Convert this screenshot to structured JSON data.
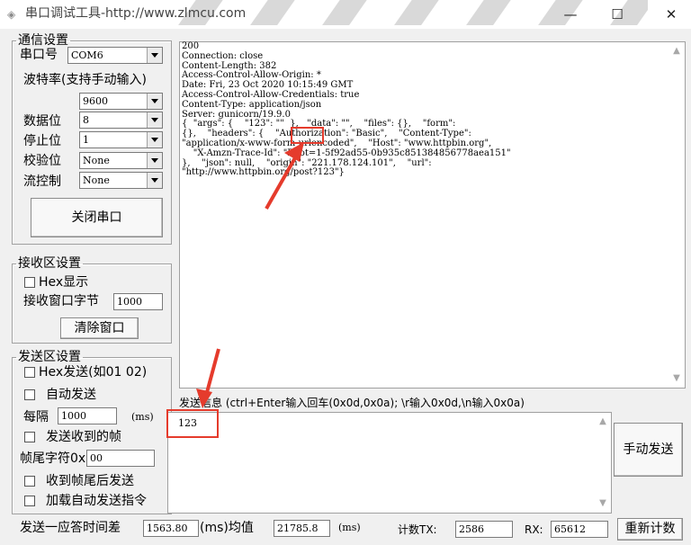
{
  "window": {
    "title": "串口调试工具-http://www.zlmcu.com",
    "minimize": "—",
    "maximize": "☐",
    "close": "✕"
  },
  "comm": {
    "legend": "通信设置",
    "port_label": "串口号",
    "port_value": "COM6",
    "baud_label": "波特率(支持手动输入)",
    "baud_value": "9600",
    "databits_label": "数据位",
    "databits_value": "8",
    "stopbits_label": "停止位",
    "stopbits_value": "1",
    "parity_label": "校验位",
    "parity_value": "None",
    "flow_label": "流控制",
    "flow_value": "None",
    "close_port_button": "关闭串口"
  },
  "receive": {
    "legend": "接收区设置",
    "hex_display_label": "Hex显示",
    "window_bytes_label": "接收窗口字节",
    "window_bytes_value": "1000",
    "clear_button": "清除窗口",
    "output_lines": [
      "200",
      "Connection: close",
      "Content-Length: 382",
      "Access-Control-Allow-Origin: *",
      "Date: Fri, 23 Oct 2020 10:15:49 GMT",
      "Access-Control-Allow-Credentials: true",
      "Content-Type: application/json",
      "Server: gunicorn/19.9.0",
      "{  \"args\": {    \"123\": \"\"  },   \"data\": \"\",    \"files\": {},    \"form\":",
      "{},    \"headers\": {    \"Authorization\": \"Basic\",    \"Content-Type\":",
      "\"application/x-www-form-urlencoded\",    \"Host\": \"www.httpbin.org\",",
      "    \"X-Amzn-Trace-Id\": \"Root=1-5f92ad55-0b935c851384856778aea151\"",
      "},    \"json\": null,    \"origin\": \"221.178.124.101\",    \"url\":",
      "\"http://www.httpbin.org/post?123\"}"
    ]
  },
  "send": {
    "legend": "发送区设置",
    "hex_send_label": "Hex发送(如01 02)",
    "auto_send_label": "自动发送",
    "interval_prefix": "每隔",
    "interval_value": "1000",
    "interval_unit": "(ms)",
    "send_on_frame_label": "发送收到的帧",
    "frame_tail_label": "帧尾字符0x",
    "frame_tail_value": "00",
    "send_after_tail_label": "收到帧尾后发送",
    "load_auto_cmd_label": "加载自动发送指令",
    "info_label": "发送信息 (ctrl+Enter输入回车(0x0d,0x0a); \\r输入0x0d,\\n输入0x0a)",
    "input_value": "123",
    "manual_send_button": "手动发送"
  },
  "status": {
    "response_time_label": "发送一应答时间差",
    "response_time_value": "1563.80",
    "ms_avg_label": "(ms)均值",
    "avg_value": "21785.8",
    "ms_label": "(ms)",
    "tx_label": "计数TX:",
    "tx_value": "2586",
    "rx_label": "RX:",
    "rx_value": "65612",
    "reset_button": "重新计数"
  },
  "colors": {
    "annotation_red": "#e53b2c"
  }
}
